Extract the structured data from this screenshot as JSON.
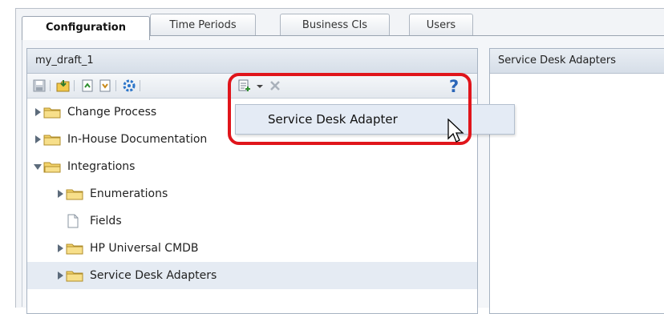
{
  "tabs": [
    {
      "label": "Configuration",
      "active": true
    },
    {
      "label": "Time Periods",
      "active": false
    },
    {
      "label": "Business CIs",
      "active": false
    },
    {
      "label": "Users",
      "active": false
    }
  ],
  "left_panel": {
    "title": "my_draft_1",
    "toolbar": {
      "icons": [
        "save-icon",
        "import-icon",
        "move-up-icon",
        "move-down-icon",
        "gear-icon",
        "new-item-icon",
        "dropdown-arrow-icon",
        "delete-icon",
        "help-icon"
      ]
    },
    "tree": [
      {
        "label": "Change Process",
        "type": "folder",
        "expanded": false,
        "level": 0
      },
      {
        "label": "In-House Documentation",
        "type": "folder",
        "expanded": false,
        "level": 0
      },
      {
        "label": "Integrations",
        "type": "folder",
        "expanded": true,
        "level": 0
      },
      {
        "label": "Enumerations",
        "type": "folder",
        "expanded": false,
        "level": 1
      },
      {
        "label": "Fields",
        "type": "file",
        "level": 1
      },
      {
        "label": "HP Universal CMDB",
        "type": "folder",
        "expanded": false,
        "level": 1
      },
      {
        "label": "Service Desk Adapters",
        "type": "folder",
        "expanded": false,
        "level": 1,
        "selected": true
      }
    ]
  },
  "right_panel": {
    "title": "Service Desk Adapters"
  },
  "dropdown_menu": {
    "items": [
      "Service Desk Adapter"
    ]
  },
  "colors": {
    "highlight": "#e0151b",
    "selection": "#e5ebf3",
    "menu_bg": "#e4ebf5"
  }
}
